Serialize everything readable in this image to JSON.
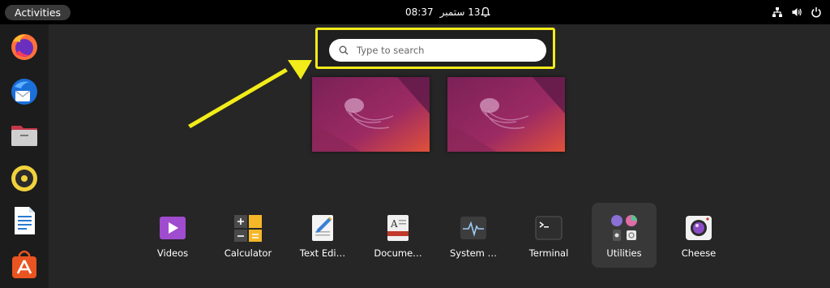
{
  "topbar": {
    "activities_label": "Activities",
    "time": "08:37",
    "date": "13 ستمبر"
  },
  "search": {
    "placeholder": "Type to search",
    "value": ""
  },
  "dock": {
    "items": [
      "firefox",
      "thunderbird",
      "files",
      "rhythmbox",
      "libreoffice-writer",
      "ubuntu-software"
    ]
  },
  "apps": {
    "videos": "Videos",
    "calculator": "Calculator",
    "text_editor": "Text Edi…",
    "document_viewer": "Docume…",
    "system_monitor": "System …",
    "terminal": "Terminal",
    "utilities": "Utilities",
    "cheese": "Cheese"
  },
  "colors": {
    "highlight": "#f2ec1a",
    "overview_bg": "#262626",
    "dock_bg": "#1c1c1c"
  }
}
